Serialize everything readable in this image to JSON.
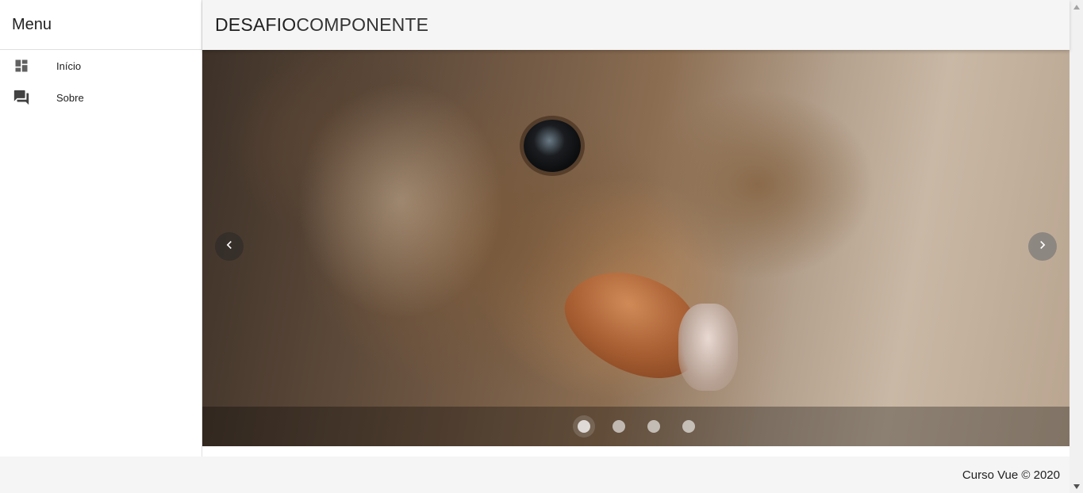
{
  "drawer": {
    "title": "Menu",
    "items": [
      {
        "label": "Início",
        "icon": "dashboard-icon"
      },
      {
        "label": "Sobre",
        "icon": "forum-icon"
      }
    ]
  },
  "toolbar": {
    "title_bold": "DESAFIO",
    "title_light": "COMPONENTE"
  },
  "carousel": {
    "slide_count": 4,
    "active_index": 0
  },
  "footer": {
    "text": "Curso Vue © 2020"
  },
  "colors": {
    "toolbar_bg": "#f5f5f5",
    "footer_bg": "#f5f5f5",
    "drawer_bg": "#ffffff",
    "text": "#212121"
  }
}
